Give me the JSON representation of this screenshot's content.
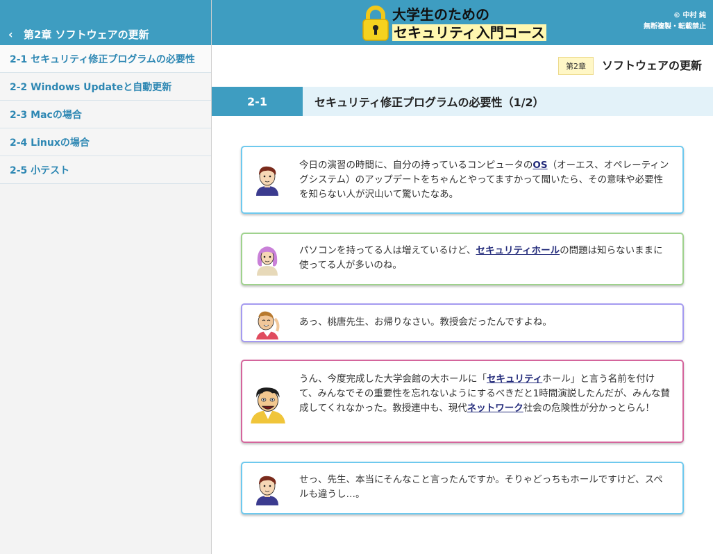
{
  "sidebar": {
    "back_label": "第2章 ソフトウェアの更新",
    "items": [
      {
        "label": "2-1 セキュリティ修正プログラムの必要性"
      },
      {
        "label": "2-2 Windows Updateと自動更新"
      },
      {
        "label": "2-3 Macの場合"
      },
      {
        "label": "2-4 Linuxの場合"
      },
      {
        "label": "2-5 小テスト"
      }
    ]
  },
  "header": {
    "logo_line1": "大学生のための",
    "logo_line2": "セキュリティ入門コース",
    "copyright_line1": "© 中村 純",
    "copyright_line2": "無断複製・転載禁止"
  },
  "chapter": {
    "badge": "第2章",
    "title": "ソフトウェアの更新"
  },
  "section": {
    "number": "2-1",
    "title": "セキュリティ修正プログラムの必要性（1/2）"
  },
  "dialogue": [
    {
      "speaker_icon": "student-boy-icon",
      "border_color": "#6ec9ee",
      "parts": [
        {
          "t": "今日の演習の時間に、自分の持っているコンピュータの"
        },
        {
          "t": "OS",
          "kw": true
        },
        {
          "t": "（オーエス、オペレーティングシステム）のアップデートをちゃんとやってますかって聞いたら、その意味や必要性を知らない人が沢山いて驚いたなあ。"
        }
      ]
    },
    {
      "speaker_icon": "student-girl-icon",
      "border_color": "#9fd28d",
      "parts": [
        {
          "t": "パソコンを持ってる人は増えているけど、"
        },
        {
          "t": "セキュリティホール",
          "kw": true
        },
        {
          "t": "の問題は知らないままに使ってる人が多いのね。"
        }
      ]
    },
    {
      "speaker_icon": "assistant-icon",
      "border_color": "#a49af0",
      "parts": [
        {
          "t": "あっ、桃唐先生、お帰りなさい。教授会だったんですよね。"
        }
      ]
    },
    {
      "speaker_icon": "professor-icon",
      "border_color": "#d4659c",
      "parts": [
        {
          "t": "うん、今度完成した大学会館の大ホールに「"
        },
        {
          "t": "セキュリティ",
          "kw": true
        },
        {
          "t": "ホール」と言う名前を付けて、みんなでその重要性を忘れないようにするべきだと1時間演説したんだが、みんな賛成してくれなかった。教授連中も、現代"
        },
        {
          "t": "ネットワーク",
          "kw": true
        },
        {
          "t": "社会の危険性が分かっとらん！"
        }
      ]
    },
    {
      "speaker_icon": "student-boy-icon",
      "border_color": "#6ec9ee",
      "parts": [
        {
          "t": "せっ、先生、本当にそんなこと言ったんですか。そりゃどっちもホールですけど、スペルも違うし…。"
        }
      ]
    }
  ]
}
